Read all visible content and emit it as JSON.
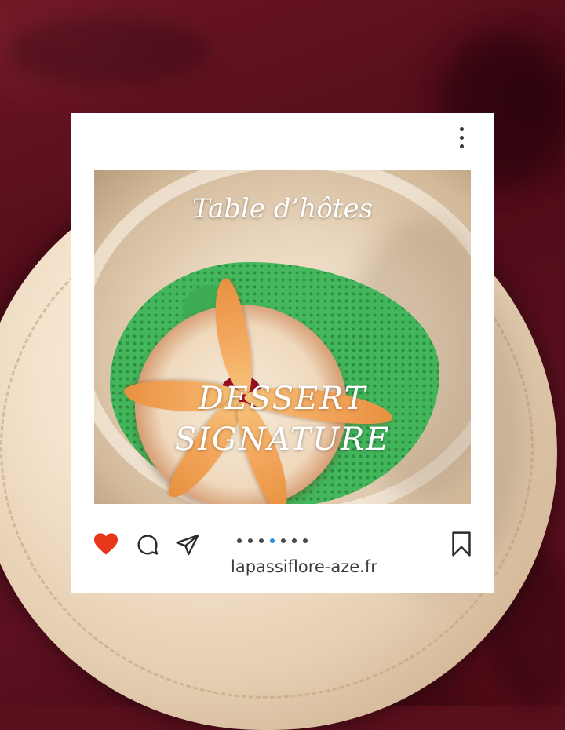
{
  "post": {
    "overlay_title": "Table d’hôtes",
    "overlay_line1": "DESSERT",
    "overlay_line2": "SIGNATURE",
    "website": "lapassiflore-aze.fr"
  },
  "carousel": {
    "total": 7,
    "active_index": 4
  },
  "colors": {
    "heart": "#e8361a",
    "active_dot": "#2a8fd6",
    "card": "#ffffff",
    "background_fabric": "#5a0f1c"
  },
  "icons": {
    "menu": "more-vertical-icon",
    "like": "heart-icon",
    "comment": "comment-bubble-icon",
    "share": "paper-plane-icon",
    "save": "bookmark-icon"
  }
}
